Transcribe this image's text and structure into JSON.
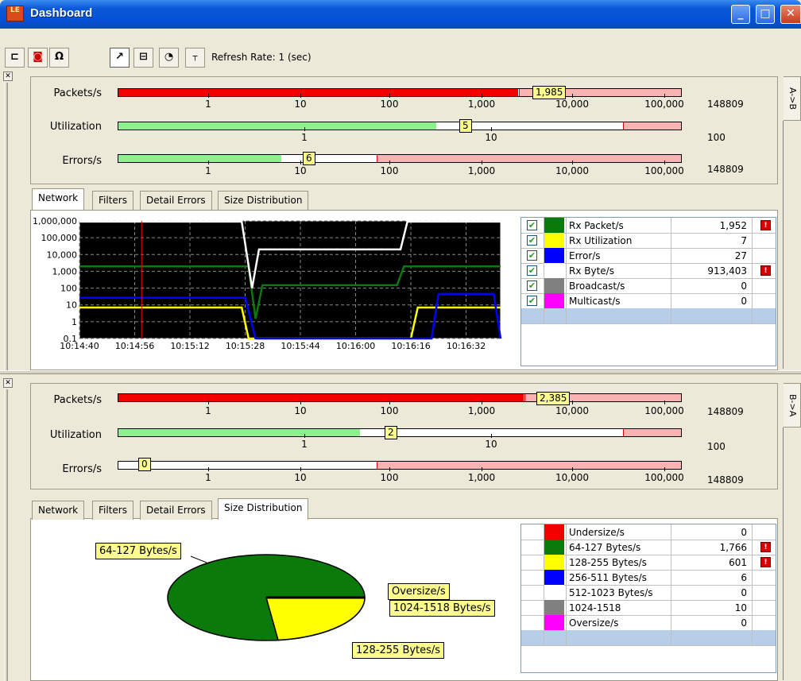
{
  "window": {
    "title": "Dashboard",
    "logo": "LE",
    "icon": "app-logo-icon"
  },
  "toolbar": {
    "refresh_label": "Refresh Rate: 1 (sec)"
  },
  "side_tabs": {
    "top": "A->B",
    "bottom": "B->A"
  },
  "colors": {
    "red": "#f20000",
    "light_red": "#f9b3b3",
    "green": "#8cf08c",
    "flag": "#fbfb8e",
    "dark_green": "#0a7a0a",
    "yellow": "#ffff00",
    "blue": "#0000ff",
    "magenta": "#ff00ff",
    "gray": "#808080"
  },
  "top": {
    "meters": [
      {
        "label": "Packets/s",
        "flag": "1,985",
        "max": "148809",
        "scale": "log",
        "ticks": [
          "1",
          "10",
          "100",
          "1,000",
          "10,000",
          "100,000"
        ],
        "fill_fraction": 0.71
      },
      {
        "label": "Utilization",
        "flag": "5",
        "max": "100",
        "scale": "log",
        "ticks": [
          "1",
          "10"
        ],
        "fill_fraction": 0.565
      },
      {
        "label": "Errors/s",
        "flag": "6",
        "max": "148809",
        "scale": "log",
        "ticks": [
          "1",
          "10",
          "100",
          "1,000",
          "10,000",
          "100,000"
        ],
        "fill_fraction": 0.29
      }
    ],
    "tabs": [
      "Network",
      "Filters",
      "Detail Errors",
      "Size Distribution"
    ],
    "active_tab": "Network",
    "legend": [
      {
        "name": "Rx Packet/s",
        "value": "1,952",
        "color": "#0a7a0a",
        "alarm": true
      },
      {
        "name": "Rx Utilization",
        "value": "7",
        "color": "#ffff00",
        "alarm": false
      },
      {
        "name": "Error/s",
        "value": "27",
        "color": "#0000ff",
        "alarm": false
      },
      {
        "name": "Rx Byte/s",
        "value": "913,403",
        "color": "#ffffff",
        "alarm": true
      },
      {
        "name": "Broadcast/s",
        "value": "0",
        "color": "#808080",
        "alarm": false
      },
      {
        "name": "Multicast/s",
        "value": "0",
        "color": "#ff00ff",
        "alarm": false
      }
    ]
  },
  "bottom": {
    "meters": [
      {
        "label": "Packets/s",
        "flag": "2,385",
        "max": "148809",
        "scale": "log",
        "ticks": [
          "1",
          "10",
          "100",
          "1,000",
          "10,000",
          "100,000"
        ],
        "fill_fraction": 0.72
      },
      {
        "label": "Utilization",
        "flag": "2",
        "max": "100",
        "scale": "log",
        "ticks": [
          "1",
          "10"
        ],
        "fill_fraction": 0.43
      },
      {
        "label": "Errors/s",
        "flag": "0",
        "max": "148809",
        "scale": "log",
        "ticks": [
          "1",
          "10",
          "100",
          "1,000",
          "10,000",
          "100,000"
        ],
        "fill_fraction": 0.0
      }
    ],
    "tabs": [
      "Network",
      "Filters",
      "Detail Errors",
      "Size Distribution"
    ],
    "active_tab": "Size Distribution",
    "pie_labels": {
      "l64": "64-127 Bytes/s",
      "lover": "Oversize/s",
      "l1024": "1024-1518 Bytes/s",
      "l128": "128-255 Bytes/s"
    },
    "legend": [
      {
        "name": "Undersize/s",
        "value": "0",
        "color": "#f20000",
        "alarm": false
      },
      {
        "name": "64-127 Bytes/s",
        "value": "1,766",
        "color": "#0a7a0a",
        "alarm": true
      },
      {
        "name": "128-255 Bytes/s",
        "value": "601",
        "color": "#ffff00",
        "alarm": true
      },
      {
        "name": "256-511 Bytes/s",
        "value": "6",
        "color": "#0000ff",
        "alarm": false
      },
      {
        "name": "512-1023 Bytes/s",
        "value": "0",
        "color": "#ffffff",
        "alarm": false
      },
      {
        "name": "1024-1518",
        "value": "10",
        "color": "#808080",
        "alarm": false
      },
      {
        "name": "Oversize/s",
        "value": "0",
        "color": "#ff00ff",
        "alarm": false
      }
    ]
  },
  "chart_data": {
    "type": "line",
    "yscale": "log",
    "y_ticks": [
      "1,000,000",
      "100,000",
      "10,000",
      "1,000",
      "100",
      "10",
      "1",
      "0.1"
    ],
    "x_ticks": [
      "10:14:40",
      "10:14:56",
      "10:15:12",
      "10:15:28",
      "10:15:44",
      "10:16:00",
      "10:16:16",
      "10:16:32"
    ],
    "grid": true,
    "series": [
      {
        "name": "Rx Packet/s",
        "color": "#0a7a0a",
        "x": [
          "10:14:40",
          "10:15:29",
          "10:15:31",
          "10:15:33",
          "10:16:12",
          "10:16:14",
          "10:16:42"
        ],
        "values": [
          1952,
          1952,
          1.5,
          150,
          150,
          1952,
          1952
        ]
      },
      {
        "name": "Rx Utilization",
        "color": "#ffff00",
        "x": [
          "10:14:40",
          "10:15:27",
          "10:15:29",
          "10:16:16",
          "10:16:18",
          "10:16:42"
        ],
        "values": [
          7,
          7,
          0.1,
          0.1,
          7,
          7
        ]
      },
      {
        "name": "Error/s",
        "color": "#0000ff",
        "x": [
          "10:14:40",
          "10:15:28",
          "10:15:31",
          "10:16:22",
          "10:16:24",
          "10:16:40",
          "10:16:42"
        ],
        "values": [
          27,
          27,
          0.1,
          0.1,
          45,
          45,
          0.1
        ]
      },
      {
        "name": "Rx Byte/s",
        "color": "#ffffff",
        "x": [
          "10:14:40",
          "10:15:27",
          "10:15:30",
          "10:15:32",
          "10:16:13",
          "10:16:15",
          "10:16:42"
        ],
        "values": [
          913403,
          913403,
          100,
          20000,
          20000,
          913403,
          913403
        ]
      }
    ],
    "cursor_x": "10:14:58"
  },
  "pie_data": {
    "type": "pie",
    "labels": [
      "64-127 Bytes/s",
      "128-255 Bytes/s",
      "256-511 Bytes/s",
      "1024-1518",
      "Oversize/s"
    ],
    "values": [
      1766,
      601,
      6,
      10,
      0
    ]
  }
}
